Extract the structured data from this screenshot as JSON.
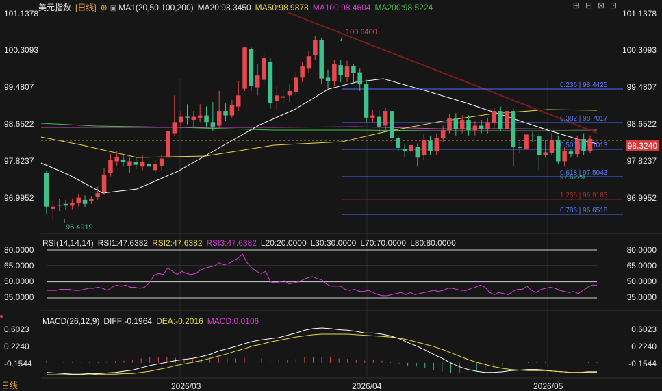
{
  "header": {
    "title": "美元指数",
    "period_tag": "[日线]",
    "ma1": "MA1(20,50,100,200)",
    "ma20": "MA20:98.3450",
    "ma50": "MA50:98.9878",
    "ma100": "MA100:98.4604",
    "ma200": "MA200:98.5224"
  },
  "rsi_header": {
    "rsi": "RSI(14,14,14)",
    "rsi1": "RSI1:47.6382",
    "rsi2": "RSI2:47.6382",
    "rsi3": "RSI3:47.6382",
    "l20": "L20:20.0000",
    "l30": "L30:30.0000",
    "l70": "L70:70.0000",
    "l80": "L80:80.0000"
  },
  "macd_header": {
    "macd": "MACD(26,12,9)",
    "diff": "DIFF:-0.1964",
    "dea": "DEA:-0.2016",
    "macd_val": "MACD:0.0106"
  },
  "price_axis": [
    "101.1378",
    "100.3093",
    "99.4807",
    "98.6522",
    "97.8237",
    "96.9952"
  ],
  "rsi_axis": [
    "80.0000",
    "65.0000",
    "50.0000",
    "35.0000"
  ],
  "macd_axis": [
    "0.6023",
    "0.2240",
    "-0.1544"
  ],
  "time_axis": [
    "2026/03",
    "2026/04",
    "2026/05"
  ],
  "current_price": "98.3240",
  "period_button": "日线",
  "colors": {
    "up": "#e5484d",
    "down": "#3ec08a",
    "ma20": "#ffffff",
    "ma50": "#e6d84a",
    "ma100": "#d140d1",
    "ma200": "#46c046",
    "fib": "#3a5bff",
    "trend": "#7a1c1c"
  },
  "chart_data": {
    "type": "candlestick",
    "symbol": "美元指数",
    "price_range": [
      96.4,
      101.3
    ],
    "annotations": {
      "high": "100.6400",
      "low": "96.4919",
      "last_low": "97.6229"
    },
    "fibonacci": [
      {
        "label": "0.236 | 98.4425"
      },
      {
        "label": "0.382 | 98.7017"
      },
      {
        "label": "0.500 | 98.1013"
      },
      {
        "label": "0.618 | 97.5043"
      },
      {
        "label": "1.236 | 96.9185"
      },
      {
        "label": "0.786 | 96.6518"
      }
    ],
    "candles": [
      [
        97.55,
        96.8,
        97.62,
        96.62
      ],
      [
        96.75,
        96.8,
        96.92,
        96.48
      ],
      [
        96.82,
        96.84,
        96.98,
        96.7
      ],
      [
        96.86,
        96.82,
        96.95,
        96.72
      ],
      [
        96.82,
        96.88,
        96.98,
        96.74
      ],
      [
        96.88,
        97.0,
        97.08,
        96.8
      ],
      [
        96.95,
        96.86,
        97.05,
        96.78
      ],
      [
        96.92,
        96.98,
        97.04,
        96.86
      ],
      [
        97.02,
        97.1,
        97.25,
        96.95
      ],
      [
        97.12,
        97.52,
        97.66,
        97.06
      ],
      [
        97.55,
        97.85,
        97.98,
        97.48
      ],
      [
        97.82,
        97.92,
        98.05,
        97.72
      ],
      [
        97.86,
        97.8,
        97.95,
        97.7
      ],
      [
        97.72,
        97.82,
        97.9,
        97.55
      ],
      [
        97.8,
        97.74,
        97.92,
        97.64
      ],
      [
        97.7,
        97.8,
        97.95,
        97.62
      ],
      [
        97.76,
        97.7,
        97.9,
        97.6
      ],
      [
        97.62,
        97.75,
        97.85,
        97.55
      ],
      [
        97.72,
        97.88,
        97.98,
        97.62
      ],
      [
        97.9,
        98.5,
        98.55,
        97.8
      ],
      [
        98.45,
        98.7,
        99.3,
        98.4
      ],
      [
        98.7,
        98.82,
        98.95,
        98.55
      ],
      [
        98.82,
        98.8,
        99.1,
        98.65
      ],
      [
        98.75,
        98.82,
        98.95,
        98.58
      ],
      [
        98.8,
        98.85,
        99.1,
        98.7
      ],
      [
        98.85,
        98.7,
        99.05,
        98.6
      ],
      [
        98.7,
        98.6,
        99.15,
        98.5
      ],
      [
        98.62,
        98.95,
        99.4,
        98.55
      ],
      [
        98.95,
        98.85,
        99.12,
        98.72
      ],
      [
        98.85,
        99.08,
        99.2,
        98.8
      ],
      [
        99.05,
        99.3,
        99.62,
        98.95
      ],
      [
        99.45,
        100.38,
        100.4,
        99.4
      ],
      [
        100.35,
        99.52,
        100.38,
        99.4
      ],
      [
        99.48,
        99.75,
        100.0,
        99.3
      ],
      [
        99.65,
        100.15,
        100.25,
        99.5
      ],
      [
        100.05,
        99.12,
        100.14,
        99.0
      ],
      [
        99.18,
        99.3,
        99.5,
        98.98
      ],
      [
        99.25,
        99.28,
        99.45,
        99.1
      ],
      [
        99.3,
        99.4,
        99.55,
        99.15
      ],
      [
        99.38,
        99.7,
        99.82,
        99.3
      ],
      [
        99.7,
        99.95,
        100.05,
        99.6
      ],
      [
        99.9,
        100.18,
        100.3,
        99.8
      ],
      [
        100.2,
        100.55,
        100.64,
        100.1
      ],
      [
        100.55,
        99.68,
        100.6,
        99.55
      ],
      [
        99.7,
        99.62,
        99.88,
        99.45
      ],
      [
        99.62,
        100.0,
        100.1,
        99.52
      ],
      [
        99.98,
        99.75,
        100.1,
        99.6
      ],
      [
        99.72,
        99.95,
        100.08,
        99.6
      ],
      [
        99.96,
        99.8,
        100.0,
        99.55
      ],
      [
        99.82,
        99.55,
        99.9,
        99.4
      ],
      [
        99.55,
        98.8,
        99.65,
        98.7
      ],
      [
        98.8,
        98.85,
        98.98,
        98.7
      ],
      [
        98.82,
        98.6,
        98.98,
        98.45
      ],
      [
        98.62,
        98.95,
        99.02,
        98.52
      ],
      [
        98.95,
        98.35,
        99.0,
        98.3
      ],
      [
        98.35,
        98.12,
        98.4,
        98.05
      ],
      [
        98.1,
        98.05,
        98.2,
        97.92
      ],
      [
        98.05,
        98.18,
        98.25,
        97.95
      ],
      [
        98.15,
        97.9,
        98.22,
        97.7
      ],
      [
        97.95,
        98.3,
        98.42,
        97.85
      ],
      [
        98.28,
        98.05,
        98.4,
        97.95
      ],
      [
        98.05,
        98.35,
        98.45,
        97.95
      ],
      [
        98.35,
        98.52,
        98.62,
        98.25
      ],
      [
        98.52,
        98.78,
        98.88,
        98.45
      ],
      [
        98.78,
        98.55,
        98.9,
        98.4
      ],
      [
        98.55,
        98.75,
        98.85,
        98.45
      ],
      [
        98.75,
        98.52,
        98.85,
        98.4
      ],
      [
        98.52,
        98.62,
        98.72,
        98.4
      ],
      [
        98.62,
        98.55,
        98.75,
        98.45
      ],
      [
        98.55,
        98.7,
        98.8,
        98.45
      ],
      [
        98.68,
        98.95,
        99.02,
        98.55
      ],
      [
        98.95,
        98.55,
        99.05,
        98.5
      ],
      [
        98.55,
        98.95,
        99.05,
        98.5
      ],
      [
        98.95,
        98.15,
        99.0,
        97.7
      ],
      [
        98.15,
        98.12,
        98.25,
        98.0
      ],
      [
        98.1,
        98.42,
        98.52,
        98.05
      ],
      [
        98.4,
        98.38,
        98.48,
        98.25
      ],
      [
        98.38,
        97.95,
        98.45,
        97.62
      ],
      [
        97.95,
        98.02,
        98.3,
        97.9
      ],
      [
        98.0,
        98.3,
        98.45,
        97.95
      ],
      [
        98.3,
        97.82,
        98.4,
        97.75
      ],
      [
        97.82,
        98.05,
        98.15,
        97.7
      ],
      [
        98.04,
        97.98,
        98.1,
        97.9
      ],
      [
        97.98,
        98.32,
        98.4,
        97.9
      ],
      [
        98.32,
        98.05,
        98.45,
        97.95
      ],
      [
        98.05,
        98.32,
        98.4,
        98.0
      ]
    ],
    "rsi_series": [
      42,
      42,
      42,
      43,
      43,
      43,
      42,
      42,
      43,
      44,
      44,
      45,
      44,
      42,
      45,
      47,
      46,
      47,
      45,
      45,
      44,
      45,
      49,
      56,
      58,
      57,
      63,
      60,
      57,
      60,
      58,
      57,
      58,
      61,
      63,
      64,
      65,
      68,
      66,
      67,
      70,
      72,
      76,
      68,
      63,
      60,
      58,
      60,
      50,
      49,
      50,
      51,
      48,
      49,
      50,
      52,
      54,
      55,
      53,
      52,
      48,
      46,
      46,
      46,
      43,
      42,
      43,
      41,
      41,
      42,
      40,
      38,
      37,
      37,
      38,
      39,
      40,
      38,
      40,
      38,
      39,
      40,
      41,
      42,
      41,
      42,
      44,
      44,
      43,
      42,
      42,
      44,
      45,
      47,
      45,
      40,
      38,
      40,
      39,
      38,
      41,
      43,
      43,
      46,
      42,
      40,
      43,
      44,
      45,
      44,
      42,
      41,
      40,
      41,
      39,
      42,
      45,
      47,
      47
    ],
    "diff_series": [
      -0.2,
      -0.21,
      -0.22,
      -0.23,
      -0.23,
      -0.22,
      -0.22,
      -0.21,
      -0.2,
      -0.18,
      -0.16,
      -0.12,
      -0.08,
      -0.05,
      -0.02,
      0.01,
      0.03,
      0.05,
      0.08,
      0.12,
      0.18,
      0.22,
      0.26,
      0.31,
      0.35,
      0.38,
      0.4,
      0.42,
      0.46,
      0.5,
      0.55,
      0.58,
      0.59,
      0.58,
      0.56,
      0.55,
      0.53,
      0.5,
      0.5,
      0.48,
      0.45,
      0.4,
      0.33,
      0.27,
      0.2,
      0.12,
      0.05,
      -0.03,
      -0.1,
      -0.15,
      -0.18,
      -0.2,
      -0.2,
      -0.19,
      -0.17,
      -0.16,
      -0.15,
      -0.15,
      -0.16,
      -0.18,
      -0.19,
      -0.2,
      -0.2,
      -0.19,
      -0.19
    ],
    "dea_series": [
      -0.24,
      -0.24,
      -0.24,
      -0.24,
      -0.24,
      -0.24,
      -0.23,
      -0.23,
      -0.23,
      -0.22,
      -0.22,
      -0.2,
      -0.18,
      -0.15,
      -0.12,
      -0.08,
      -0.05,
      -0.02,
      0.01,
      0.05,
      0.09,
      0.13,
      0.18,
      0.22,
      0.27,
      0.3,
      0.34,
      0.37,
      0.4,
      0.43,
      0.45,
      0.47,
      0.48,
      0.48,
      0.48,
      0.48,
      0.47,
      0.46,
      0.45,
      0.44,
      0.43,
      0.41,
      0.38,
      0.34,
      0.3,
      0.26,
      0.21,
      0.15,
      0.09,
      0.03,
      -0.02,
      -0.06,
      -0.1,
      -0.13,
      -0.15,
      -0.16,
      -0.17,
      -0.17,
      -0.17,
      -0.18,
      -0.19,
      -0.2,
      -0.2,
      -0.2,
      -0.2
    ]
  }
}
